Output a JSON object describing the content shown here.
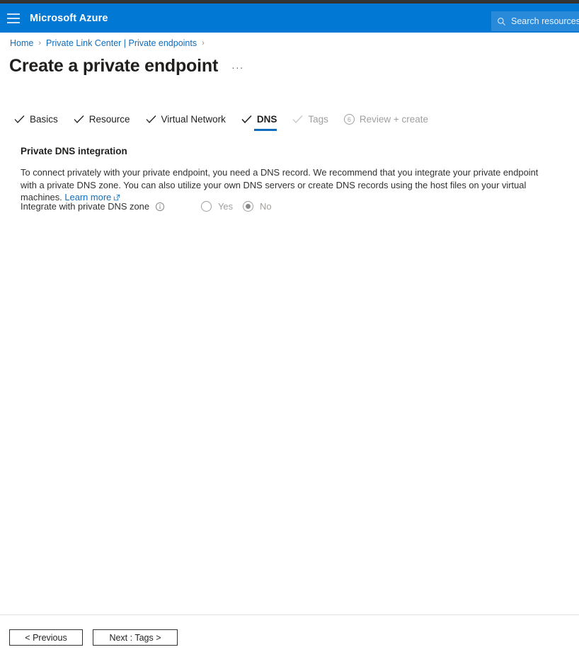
{
  "header": {
    "menu_icon": "hamburger-icon",
    "brand": "Microsoft Azure",
    "search_icon": "search-icon",
    "search_placeholder": "Search resources",
    "bar_color": "#0078d4",
    "top_strip_color": "#333333"
  },
  "breadcrumb": {
    "items": [
      {
        "label": "Home"
      },
      {
        "label": "Private Link Center | Private endpoints"
      }
    ],
    "separator": "›",
    "link_color": "#0f6cbd"
  },
  "title": {
    "text": "Create a private endpoint",
    "more_actions": "···"
  },
  "tabs": [
    {
      "label": "Basics",
      "state": "done",
      "icon": "checkmark-icon"
    },
    {
      "label": "Resource",
      "state": "done",
      "icon": "checkmark-icon"
    },
    {
      "label": "Virtual Network",
      "state": "done",
      "icon": "checkmark-icon"
    },
    {
      "label": "DNS",
      "state": "active",
      "icon": "checkmark-icon"
    },
    {
      "label": "Tags",
      "state": "disabled",
      "icon": "checkmark-icon"
    },
    {
      "label": "Review + create",
      "state": "disabled",
      "icon": "step-number-icon",
      "step": "6"
    }
  ],
  "active_tab_underline_color": "#0f6cbd",
  "content": {
    "section_title": "Private DNS integration",
    "description_part1": "To connect privately with your private endpoint, you need a DNS record. We recommend that you integrate your private endpoint with a private DNS zone. You can also utilize your own DNS servers or create DNS records using the host files on your virtual machines.",
    "learn_more": "Learn more",
    "learn_more_icon": "external-link-icon",
    "field_label": "Integrate with private DNS zone",
    "info_icon": "info-circle-icon",
    "radio_options": [
      {
        "label": "Yes",
        "selected": false
      },
      {
        "label": "No",
        "selected": true
      }
    ]
  },
  "footer": {
    "previous_label": "< Previous",
    "next_label": "Next : Tags >"
  }
}
